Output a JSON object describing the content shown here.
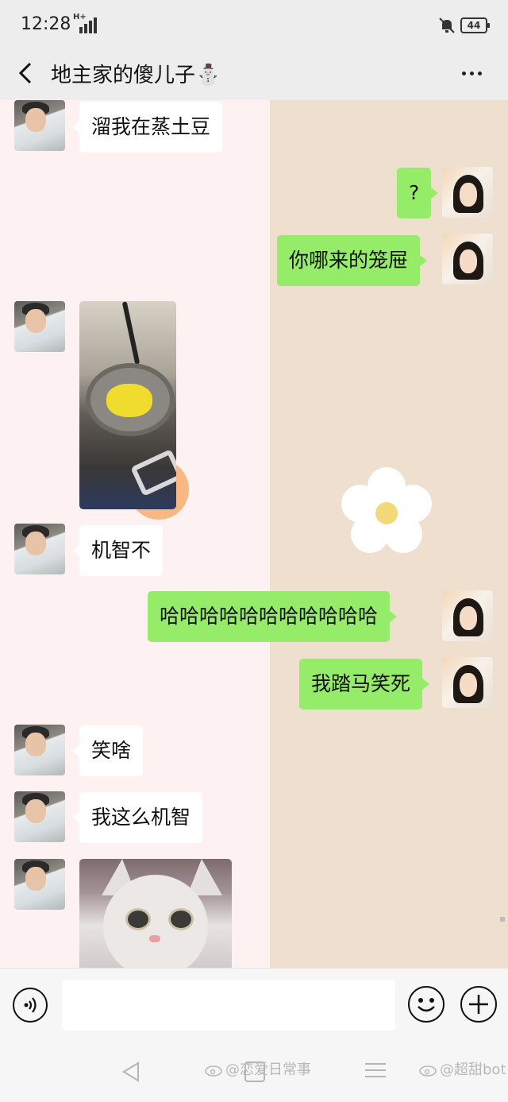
{
  "status_bar": {
    "time": "12:28",
    "network": "H+",
    "battery": "44"
  },
  "header": {
    "title": "地主家的傻儿子⛄",
    "back_icon": "chevron-left-icon",
    "more_icon": "more-dots-icon"
  },
  "messages": [
    {
      "side": "in",
      "type": "text",
      "text": "溜我在蒸土豆"
    },
    {
      "side": "out",
      "type": "text",
      "text": "?"
    },
    {
      "side": "out",
      "type": "text",
      "text": "你哪来的笼屉"
    },
    {
      "side": "in",
      "type": "image",
      "text": "",
      "subject": "potato-in-pot-photo"
    },
    {
      "side": "in",
      "type": "text",
      "text": "机智不"
    },
    {
      "side": "out",
      "type": "text",
      "text": "哈哈哈哈哈哈哈哈哈哈哈"
    },
    {
      "side": "out",
      "type": "text",
      "text": "我踏马笑死"
    },
    {
      "side": "in",
      "type": "text",
      "text": "笑啥"
    },
    {
      "side": "in",
      "type": "text",
      "text": "我这么机智"
    },
    {
      "side": "in",
      "type": "image",
      "text": "",
      "subject": "white-cat-photo"
    }
  ],
  "input_bar": {
    "message_value": "",
    "voice_icon": "voice-icon",
    "emoji_icon": "emoji-icon",
    "plus_icon": "plus-icon"
  },
  "watermarks": {
    "first": "@恋爱日常事",
    "second": "@超甜bot"
  },
  "colors": {
    "outgoing_bubble": "#95ec69",
    "incoming_bubble": "#ffffff",
    "header_bg": "#ededed",
    "wallpaper_right": "#efdfcf",
    "wallpaper_left": "#fdf1f1"
  }
}
